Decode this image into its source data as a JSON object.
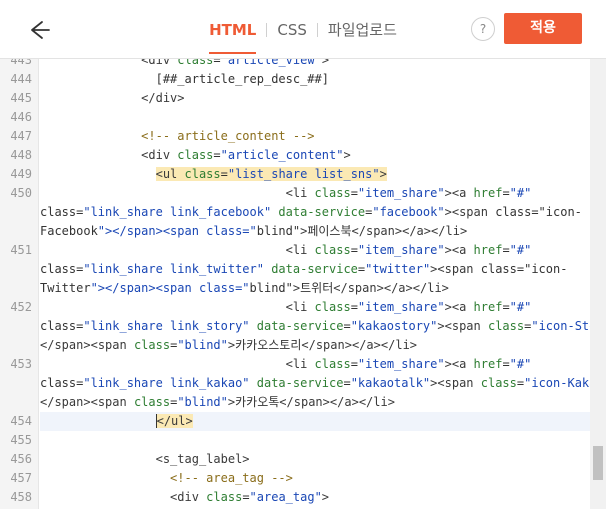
{
  "header": {
    "tabs": [
      "HTML",
      "CSS",
      "파일업로드"
    ],
    "active_tab": "HTML",
    "help_label": "?",
    "apply_label": "적용"
  },
  "editor": {
    "lines": [
      {
        "n": "443",
        "text": "              <div class=\"article_view\">"
      },
      {
        "n": "444",
        "text": "                [##_article_rep_desc_##]"
      },
      {
        "n": "445",
        "text": "              </div>"
      },
      {
        "n": "446",
        "text": ""
      },
      {
        "n": "447",
        "text": "              <!-- article_content -->"
      },
      {
        "n": "448",
        "text": "              <div class=\"article_content\">"
      },
      {
        "n": "449",
        "text": "                <ul class=\"list_share list_sns\">"
      },
      {
        "n": "450",
        "text": "                                  <li class=\"item_share\"><a href=\"#\""
      },
      {
        "n": "",
        "text": "class=\"link_share link_facebook\" data-service=\"facebook\"><span class=\"icon-"
      },
      {
        "n": "",
        "text": "Facebook\"></span><span class=\"blind\">페이스북</span></a></li>"
      },
      {
        "n": "451",
        "text": "                                  <li class=\"item_share\"><a href=\"#\""
      },
      {
        "n": "",
        "text": "class=\"link_share link_twitter\" data-service=\"twitter\"><span class=\"icon-"
      },
      {
        "n": "",
        "text": "Twitter\"></span><span class=\"blind\">트위터</span></a></li>"
      },
      {
        "n": "452",
        "text": "                                  <li class=\"item_share\"><a href=\"#\""
      },
      {
        "n": "",
        "text": "class=\"link_share link_story\" data-service=\"kakaostory\"><span class=\"icon-Story\">"
      },
      {
        "n": "",
        "text": "</span><span class=\"blind\">카카오스토리</span></a></li>"
      },
      {
        "n": "453",
        "text": "                                  <li class=\"item_share\"><a href=\"#\""
      },
      {
        "n": "",
        "text": "class=\"link_share link_kakao\" data-service=\"kakaotalk\"><span class=\"icon-Kakao\">"
      },
      {
        "n": "",
        "text": "</span><span class=\"blind\">카카오톡</span></a></li>"
      },
      {
        "n": "454",
        "text": "                </ul>"
      },
      {
        "n": "455",
        "text": ""
      },
      {
        "n": "456",
        "text": "                <s_tag_label>"
      },
      {
        "n": "457",
        "text": "                  <!-- area_tag -->"
      },
      {
        "n": "458",
        "text": "                  <div class=\"area_tag\">"
      }
    ],
    "current_line": "454",
    "highlighted_tag_line": "449",
    "scroll_position": 0.93
  }
}
